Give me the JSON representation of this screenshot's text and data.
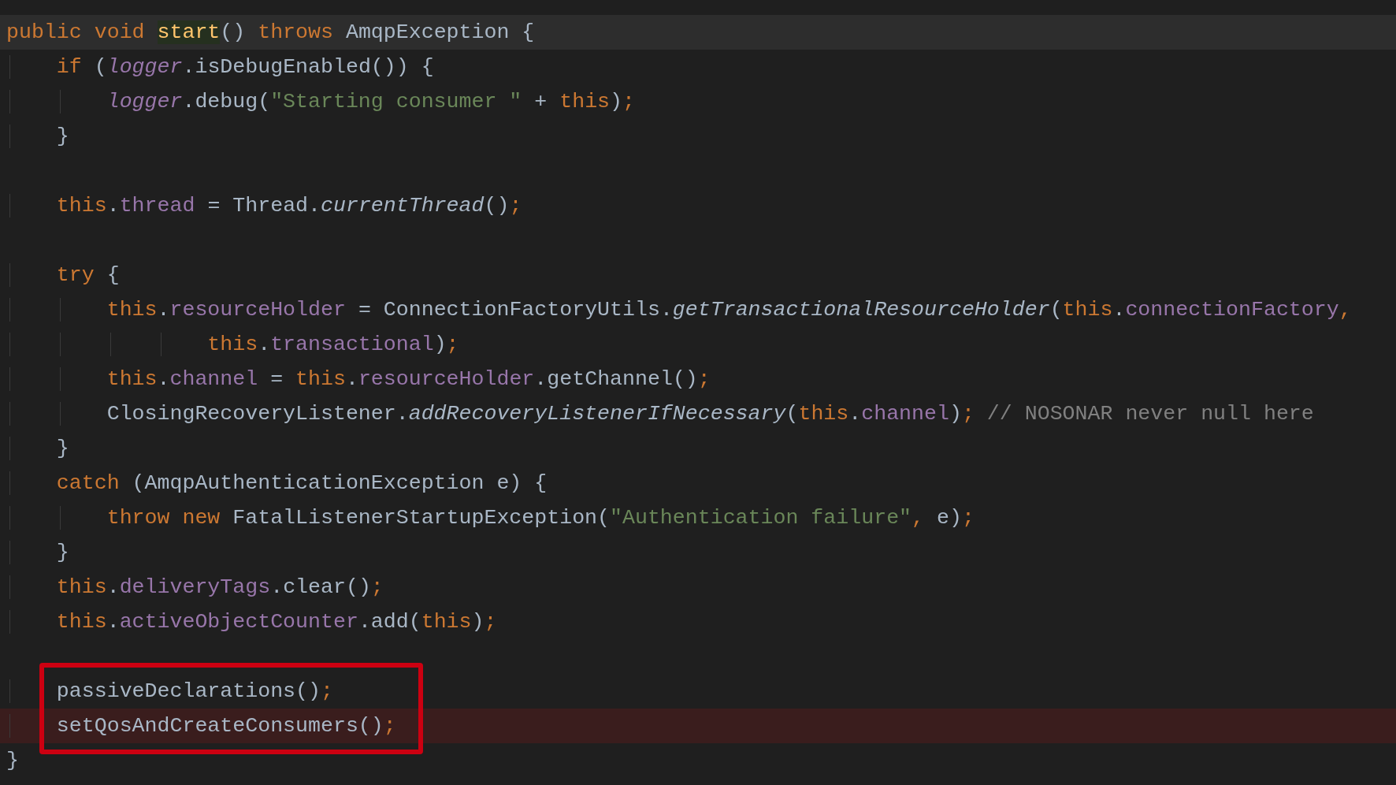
{
  "editor": {
    "blocks": [
      {
        "kind": "plain",
        "lines": [
          {
            "current": true,
            "error": false,
            "tokens": [
              {
                "text": "public void ",
                "kind": "keyword"
              },
              {
                "text": "start",
                "kind": "declaration"
              },
              {
                "text": "() ",
                "kind": "plain"
              },
              {
                "text": "throws ",
                "kind": "keyword"
              },
              {
                "text": "AmqpException {",
                "kind": "plain"
              }
            ]
          },
          {
            "current": false,
            "error": false,
            "tokens": [
              {
                "text": "    if ",
                "kind": "keyword"
              },
              {
                "text": "(",
                "kind": "plain"
              },
              {
                "text": "logger",
                "kind": "static"
              },
              {
                "text": ".isDebugEnabled()) {",
                "kind": "plain"
              }
            ]
          },
          {
            "current": false,
            "error": false,
            "tokens": [
              {
                "text": "        logger",
                "kind": "static"
              },
              {
                "text": ".debug(",
                "kind": "plain"
              },
              {
                "text": "\"Starting consumer \"",
                "kind": "string"
              },
              {
                "text": " + ",
                "kind": "plain"
              },
              {
                "text": "this",
                "kind": "keyword"
              },
              {
                "text": ")",
                "kind": "plain"
              },
              {
                "text": ";",
                "kind": "keyword"
              }
            ]
          },
          {
            "current": false,
            "error": false,
            "tokens": [
              {
                "text": "    }",
                "kind": "plain"
              }
            ]
          },
          {
            "current": false,
            "error": false
          },
          {
            "current": false,
            "error": false,
            "tokens": [
              {
                "text": "    this",
                "kind": "keyword"
              },
              {
                "text": ".",
                "kind": "plain"
              },
              {
                "text": "thread",
                "kind": "field"
              },
              {
                "text": " = Thread.",
                "kind": "plain"
              },
              {
                "text": "currentThread",
                "kind": "method"
              },
              {
                "text": "()",
                "kind": "plain"
              },
              {
                "text": ";",
                "kind": "keyword"
              }
            ]
          },
          {
            "current": false,
            "error": false
          },
          {
            "current": false,
            "error": false,
            "tokens": [
              {
                "text": "    try ",
                "kind": "keyword"
              },
              {
                "text": "{",
                "kind": "plain"
              }
            ]
          },
          {
            "current": false,
            "error": false,
            "tokens": [
              {
                "text": "        this",
                "kind": "keyword"
              },
              {
                "text": ".",
                "kind": "plain"
              },
              {
                "text": "resourceHolder",
                "kind": "field"
              },
              {
                "text": " = ConnectionFactoryUtils.",
                "kind": "plain"
              },
              {
                "text": "getTransactionalResourceHolder",
                "kind": "method"
              },
              {
                "text": "(",
                "kind": "plain"
              },
              {
                "text": "this",
                "kind": "keyword"
              },
              {
                "text": ".",
                "kind": "plain"
              },
              {
                "text": "connectionFactory",
                "kind": "field"
              },
              {
                "text": ",",
                "kind": "keyword"
              }
            ]
          },
          {
            "current": false,
            "error": false,
            "tokens": [
              {
                "text": "                this",
                "kind": "keyword"
              },
              {
                "text": ".",
                "kind": "plain"
              },
              {
                "text": "transactional",
                "kind": "field"
              },
              {
                "text": ")",
                "kind": "plain"
              },
              {
                "text": ";",
                "kind": "keyword"
              }
            ]
          },
          {
            "current": false,
            "error": false,
            "tokens": [
              {
                "text": "        this",
                "kind": "keyword"
              },
              {
                "text": ".",
                "kind": "plain"
              },
              {
                "text": "channel",
                "kind": "field"
              },
              {
                "text": " = ",
                "kind": "plain"
              },
              {
                "text": "this",
                "kind": "keyword"
              },
              {
                "text": ".",
                "kind": "plain"
              },
              {
                "text": "resourceHolder",
                "kind": "field"
              },
              {
                "text": ".getChannel()",
                "kind": "plain"
              },
              {
                "text": ";",
                "kind": "keyword"
              }
            ]
          },
          {
            "current": false,
            "error": false,
            "tokens": [
              {
                "text": "        ClosingRecoveryListener.",
                "kind": "plain"
              },
              {
                "text": "addRecoveryListenerIfNecessary",
                "kind": "method"
              },
              {
                "text": "(",
                "kind": "plain"
              },
              {
                "text": "this",
                "kind": "keyword"
              },
              {
                "text": ".",
                "kind": "plain"
              },
              {
                "text": "channel",
                "kind": "field"
              },
              {
                "text": ")",
                "kind": "plain"
              },
              {
                "text": ";",
                "kind": "keyword"
              },
              {
                "text": " // NOSONAR never null here",
                "kind": "comment"
              }
            ]
          },
          {
            "current": false,
            "error": false,
            "tokens": [
              {
                "text": "    }",
                "kind": "plain"
              }
            ]
          },
          {
            "current": false,
            "error": false,
            "tokens": [
              {
                "text": "    catch ",
                "kind": "keyword"
              },
              {
                "text": "(AmqpAuthenticationException e) {",
                "kind": "plain"
              }
            ]
          },
          {
            "current": false,
            "error": false,
            "tokens": [
              {
                "text": "        throw new ",
                "kind": "keyword"
              },
              {
                "text": "FatalListenerStartupException(",
                "kind": "plain"
              },
              {
                "text": "\"Authentication failure\"",
                "kind": "string"
              },
              {
                "text": ",",
                "kind": "keyword"
              },
              {
                "text": " e)",
                "kind": "plain"
              },
              {
                "text": ";",
                "kind": "keyword"
              }
            ]
          },
          {
            "current": false,
            "error": false,
            "tokens": [
              {
                "text": "    }",
                "kind": "plain"
              }
            ]
          },
          {
            "current": false,
            "error": false,
            "tokens": [
              {
                "text": "    this",
                "kind": "keyword"
              },
              {
                "text": ".",
                "kind": "plain"
              },
              {
                "text": "deliveryTags",
                "kind": "field"
              },
              {
                "text": ".clear()",
                "kind": "plain"
              },
              {
                "text": ";",
                "kind": "keyword"
              }
            ]
          },
          {
            "current": false,
            "error": false,
            "tokens": [
              {
                "text": "    this",
                "kind": "keyword"
              },
              {
                "text": ".",
                "kind": "plain"
              },
              {
                "text": "activeObjectCounter",
                "kind": "field"
              },
              {
                "text": ".add(",
                "kind": "plain"
              },
              {
                "text": "this",
                "kind": "keyword"
              },
              {
                "text": ")",
                "kind": "plain"
              },
              {
                "text": ";",
                "kind": "keyword"
              }
            ]
          },
          {
            "current": false,
            "error": false
          }
        ]
      },
      {
        "kind": "framed",
        "lines": [
          {
            "current": false,
            "error": false,
            "tokens": [
              {
                "text": "    passiveDeclarations()",
                "kind": "plain"
              },
              {
                "text": ";",
                "kind": "keyword"
              }
            ]
          },
          {
            "current": false,
            "error": true,
            "tokens": [
              {
                "text": "    setQosAndCreateConsumers()",
                "kind": "plain"
              },
              {
                "text": ";",
                "kind": "keyword"
              }
            ]
          }
        ]
      },
      {
        "kind": "plain",
        "lines": [
          {
            "current": false,
            "error": false,
            "tokens": [
              {
                "text": "}",
                "kind": "plain"
              }
            ]
          }
        ]
      }
    ]
  }
}
